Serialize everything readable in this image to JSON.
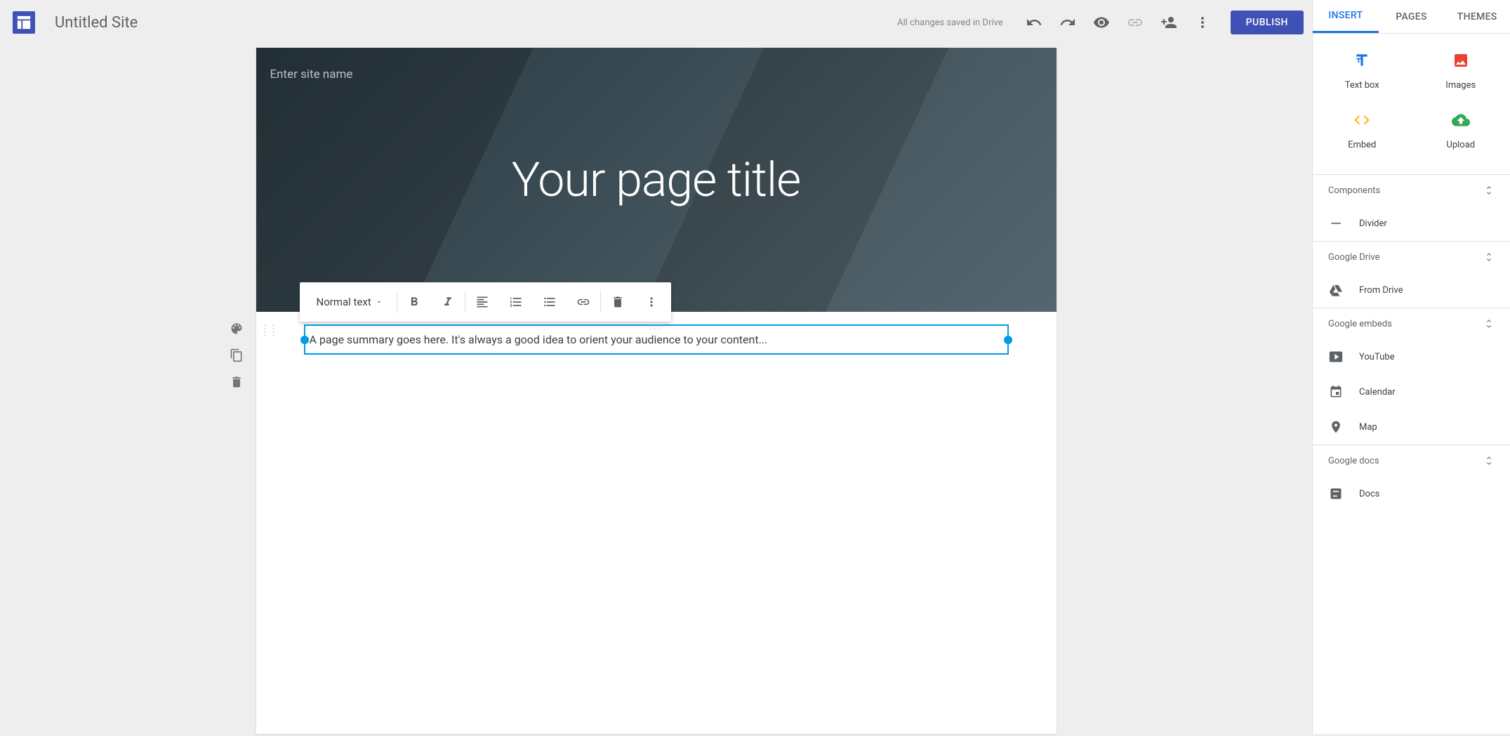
{
  "header": {
    "site_title": "Untitled Site",
    "save_status": "All changes saved in Drive",
    "publish_label": "PUBLISH"
  },
  "tabs": {
    "insert": "INSERT",
    "pages": "PAGES",
    "themes": "THEMES"
  },
  "insert_panel": {
    "primary": {
      "text_box": "Text box",
      "images": "Images",
      "embed": "Embed",
      "upload": "Upload"
    },
    "sections": {
      "components": "Components",
      "google_drive": "Google Drive",
      "google_embeds": "Google embeds",
      "google_docs": "Google docs"
    },
    "items": {
      "divider": "Divider",
      "from_drive": "From Drive",
      "youtube": "YouTube",
      "calendar": "Calendar",
      "map": "Map",
      "docs": "Docs"
    }
  },
  "canvas": {
    "site_name_placeholder": "Enter site name",
    "page_title": "Your page title",
    "summary_text": "A page summary goes here. It's always a good idea to orient your audience to your content..."
  },
  "toolbar": {
    "text_style": "Normal text"
  }
}
